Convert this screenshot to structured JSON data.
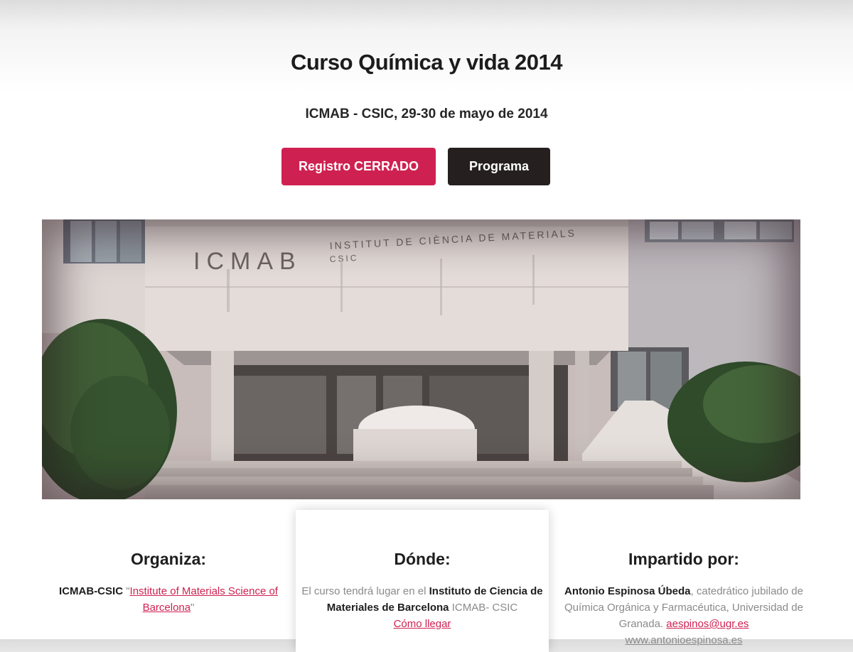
{
  "hero": {
    "title": "Curso Química y vida 2014",
    "subtitle": "ICMAB - CSIC, 29-30 de mayo de 2014",
    "buttons": {
      "registro": "Registro CERRADO",
      "programa": "Programa"
    },
    "colors": {
      "accent": "#cf2151",
      "dark": "#25201f"
    }
  },
  "photo": {
    "sign_main": "ICMAB",
    "sign_line1": "INSTITUT DE CIÈNCIA DE MATERIALS",
    "sign_line2": "CSIC"
  },
  "organiza": {
    "heading": "Organiza:",
    "org_bold": "ICMAB-CSIC",
    "quote_open": " \"",
    "link": "Institute of Materials Science of Barcelona",
    "quote_close": "\""
  },
  "donde": {
    "heading": "Dónde:",
    "text_pre": "El curso tendrá lugar en el ",
    "bold": "Instituto de Ciencia de Materiales de Barcelona",
    "text_post": " ICMAB- CSIC",
    "link": "Cómo llegar"
  },
  "impartido": {
    "heading": "Impartido por:",
    "name": "Antonio Espinosa Úbeda",
    "desc": ", catedrático jubilado de Química Orgánica y Farmacéutica, Universidad de Granada. ",
    "email": "aespinos@ugr.es",
    "web": "www.antonioespinosa.es"
  }
}
